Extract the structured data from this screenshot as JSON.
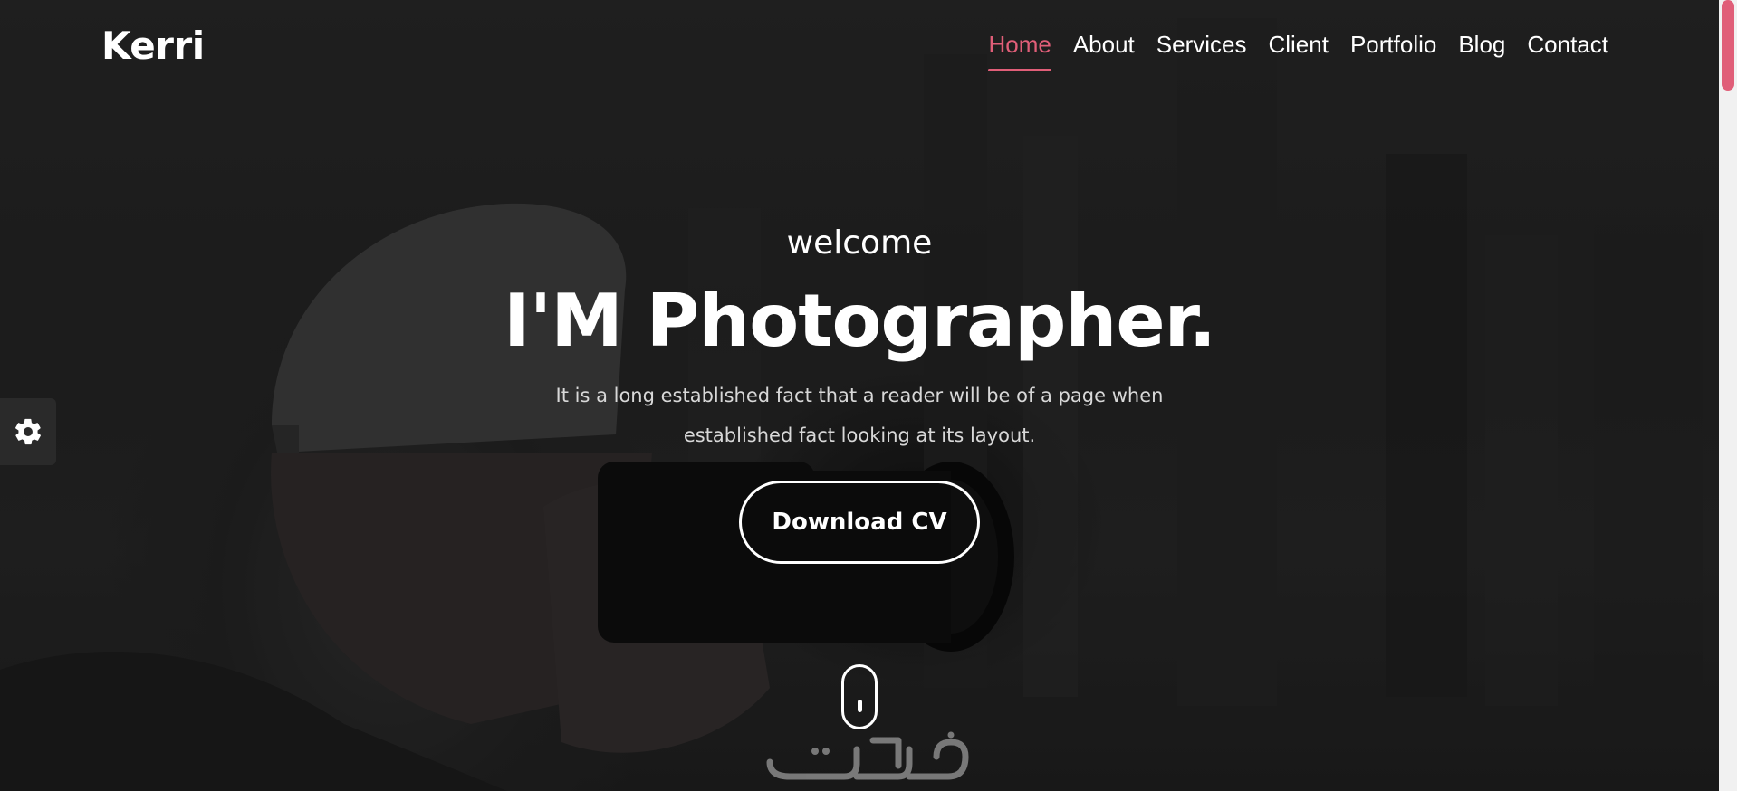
{
  "brand": {
    "name": "Kerri"
  },
  "nav": {
    "items": [
      {
        "label": "Home",
        "active": true
      },
      {
        "label": "About",
        "active": false
      },
      {
        "label": "Services",
        "active": false
      },
      {
        "label": "Client",
        "active": false
      },
      {
        "label": "Portfolio",
        "active": false
      },
      {
        "label": "Blog",
        "active": false
      },
      {
        "label": "Contact",
        "active": false
      }
    ]
  },
  "hero": {
    "welcome": "welcome",
    "headline": "I'M Photographer.",
    "subtitle": "It is a long established fact that a reader will be of a page when established fact looking at its layout.",
    "cv_button": "Download CV"
  },
  "icons": {
    "settings": "gear-icon",
    "scroll": "mouse-scroll-icon"
  },
  "watermark": {
    "text": "خمسات"
  },
  "colors": {
    "accent": "#e05e78",
    "text": "#ffffff",
    "subtitle": "#d8d8d8",
    "background": "#2b2b2b"
  }
}
